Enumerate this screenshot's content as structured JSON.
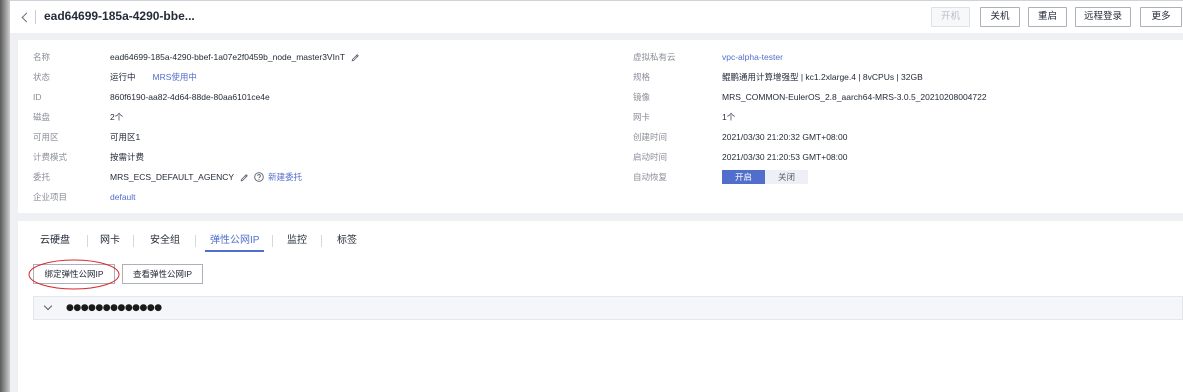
{
  "header": {
    "title": "ead64699-185a-4290-bbe...",
    "buttons": [
      {
        "label": "开机",
        "disabled": true
      },
      {
        "label": "关机",
        "disabled": false
      },
      {
        "label": "重启",
        "disabled": false
      },
      {
        "label": "远程登录",
        "disabled": false
      },
      {
        "label": "更多",
        "disabled": false
      }
    ]
  },
  "summary": {
    "left": [
      {
        "label": "名称",
        "value": "ead64699-185a-4290-bbef-1a07e2f0459b_node_master3VInT"
      },
      {
        "label": "状态",
        "value": "运行中",
        "tag": "MRS使用中"
      },
      {
        "label": "ID",
        "value": "860f6190-aa82-4d64-88de-80aa6101ce4e"
      },
      {
        "label": "磁盘",
        "value": "2个"
      },
      {
        "label": "可用区",
        "value": "可用区1"
      },
      {
        "label": "计费模式",
        "value": "按需计费"
      },
      {
        "label": "委托",
        "value": "MRS_ECS_DEFAULT_AGENCY",
        "link": "新建委托"
      },
      {
        "label": "企业项目",
        "link": "default"
      }
    ],
    "right": [
      {
        "label": "虚拟私有云",
        "link": "vpc-alpha-tester"
      },
      {
        "label": "规格",
        "value": "鲲鹏通用计算增强型 | kc1.2xlarge.4 | 8vCPUs | 32GB"
      },
      {
        "label": "镜像",
        "value": "MRS_COMMON-EulerOS_2.8_aarch64-MRS-3.0.5_20210208004722"
      },
      {
        "label": "网卡",
        "value": "1个"
      },
      {
        "label": "创建时间",
        "value": "2021/03/30 21:20:32 GMT+08:00"
      },
      {
        "label": "启动时间",
        "value": "2021/03/30 21:20:53 GMT+08:00"
      },
      {
        "label": "自动恢复",
        "toggle": {
          "options": [
            "开启",
            "关闭"
          ],
          "selected": "开启"
        }
      }
    ]
  },
  "tabs": {
    "items": [
      "云硬盘",
      "网卡",
      "安全组",
      "弹性公网IP",
      "监控",
      "标签"
    ],
    "active": "弹性公网IP"
  },
  "eip": {
    "bind_button": "绑定弹性公网IP",
    "view_button": "查看弹性公网IP",
    "rows": [
      {
        "address": "●●●●●●●●●●●●●"
      }
    ]
  },
  "icons": {
    "back": "chevron-left-icon",
    "edit": "pencil-icon",
    "help": "question-circle-icon",
    "expand": "chevron-down-icon"
  },
  "colors": {
    "accent": "#526ecc",
    "text": "#252b3a",
    "label": "#8a8e99",
    "annotation": "#d9262c"
  }
}
